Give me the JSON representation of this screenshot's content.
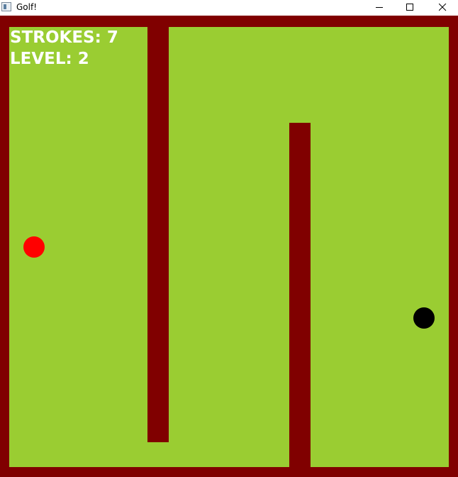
{
  "window": {
    "title": "Golf!",
    "icon": "app-window-icon",
    "controls": [
      "minimize-icon",
      "maximize-icon",
      "close-icon"
    ]
  },
  "hud": {
    "strokes_label": "STROKES: 7",
    "level_label": "LEVEL: 2"
  },
  "game": {
    "strokes": 7,
    "level": 2
  },
  "colors": {
    "wall": "#800000",
    "grass": "#9acd32",
    "ball": "#ff0000",
    "hole": "#000000",
    "hud_text": "#ffffff"
  }
}
